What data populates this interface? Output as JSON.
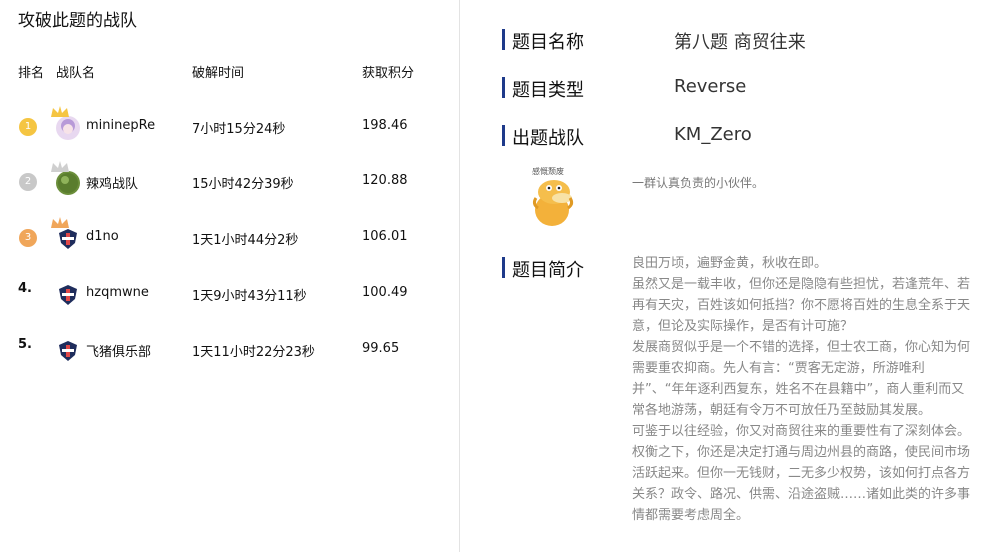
{
  "left_panel": {
    "title": "攻破此题的战队",
    "headers": {
      "rank": "排名",
      "team": "战队名",
      "time": "破解时间",
      "score": "获取积分"
    },
    "rows": [
      {
        "rank": "1",
        "medal": "gold",
        "team": "mininepRe",
        "time": "7小时15分24秒",
        "score": "198.46",
        "avatar": "anime-avatar"
      },
      {
        "rank": "2",
        "medal": "silver",
        "team": "辣鸡战队",
        "time": "15小时42分39秒",
        "score": "120.88",
        "avatar": "green-blob-avatar"
      },
      {
        "rank": "3",
        "medal": "bronze",
        "team": "d1no",
        "time": "1天1小时44分2秒",
        "score": "106.01",
        "avatar": "shield-avatar"
      },
      {
        "rank": "4.",
        "medal": "",
        "team": "hzqmwne",
        "time": "1天9小时43分11秒",
        "score": "100.49",
        "avatar": "shield-avatar"
      },
      {
        "rank": "5.",
        "medal": "",
        "team": "飞猪俱乐部",
        "time": "1天11小时22分23秒",
        "score": "99.65",
        "avatar": "shield-avatar"
      }
    ]
  },
  "right_panel": {
    "name_label": "题目名称",
    "name_value": "第八题 商贸往来",
    "type_label": "题目类型",
    "type_value": "Reverse",
    "team_label": "出题战队",
    "team_value": "KM_Zero",
    "team_desc": "一群认真负责的小伙伴。",
    "mascot_caption": "感慨颓废",
    "intro_label": "题目简介",
    "intro_lines": [
      "良田万顷，遍野金黄，秋收在即。",
      "虽然又是一载丰收，但你还是隐隐有些担忧，若逢荒年、若再有天灾，百姓该如何抵挡？你不愿将百姓的生息全系于天意，但论及实际操作，是否有计可施？",
      "发展商贸似乎是一个不错的选择，但士农工商，你心知为何需要重农抑商。先人有言：“贾客无定游，所游唯利并”、“年年逐利西复东，姓名不在县籍中”，商人重利而又常各地游荡，朝廷有令万不可放任乃至鼓励其发展。",
      "可鉴于以往经验，你又对商贸往来的重要性有了深刻体会。",
      "权衡之下，你还是决定打通与周边州县的商路，使民间市场活跃起来。但你一无钱财，二无多少权势，该如何打点各方关系？政令、路况、供需、沿途盗贼……诸如此类的许多事情都需要考虑周全。"
    ]
  },
  "colors": {
    "accent_bar": "#1e3a8a",
    "gold": "#f5c542",
    "silver": "#c8c8c8",
    "bronze": "#f0a65a"
  }
}
